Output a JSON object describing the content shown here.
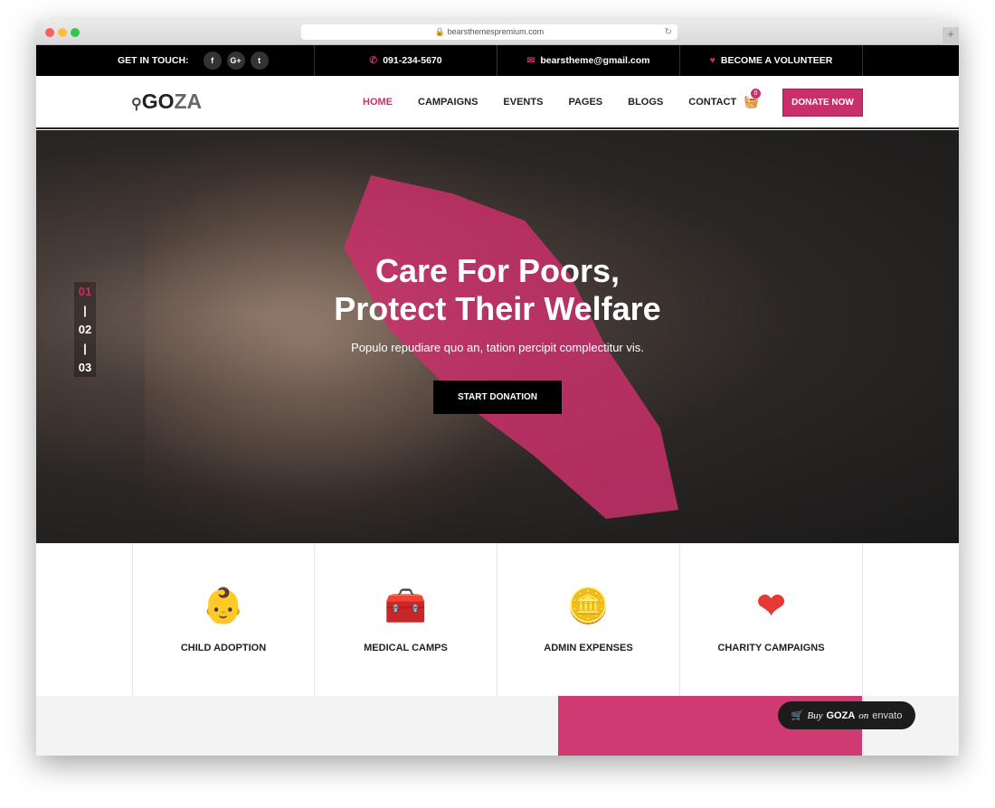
{
  "browser": {
    "url": "bearsthemespremium.com"
  },
  "topbar": {
    "get_in_touch": "GET IN TOUCH:",
    "social": [
      "f",
      "G+",
      "t"
    ],
    "phone": "091-234-5670",
    "email": "bearstheme@gmail.com",
    "volunteer": "BECOME A VOLUNTEER"
  },
  "nav": {
    "logo_a": "GO",
    "logo_b": "ZA",
    "items": [
      "HOME",
      "CAMPAIGNS",
      "EVENTS",
      "PAGES",
      "BLOGS",
      "CONTACT"
    ],
    "cart_count": "0",
    "donate": "DONATE NOW"
  },
  "hero": {
    "title_1": "Care For Poors,",
    "title_2": "Protect Their Welfare",
    "subtitle": "Populo repudiare quo an, tation percipit complectitur vis.",
    "cta": "START DONATION",
    "slides": [
      "01",
      "02",
      "03"
    ]
  },
  "features": [
    {
      "label": "CHILD ADOPTION",
      "icon": "baby-icon"
    },
    {
      "label": "MEDICAL CAMPS",
      "icon": "first-aid-kit-icon"
    },
    {
      "label": "ADMIN EXPENSES",
      "icon": "coin-icon"
    },
    {
      "label": "CHARITY CAMPAIGNS",
      "icon": "heart-hand-icon"
    }
  ],
  "buy_badge": {
    "buy": "Buy",
    "name": "GOZA",
    "on": "on",
    "brand": "envato"
  },
  "colors": {
    "accent": "#c9306a"
  }
}
